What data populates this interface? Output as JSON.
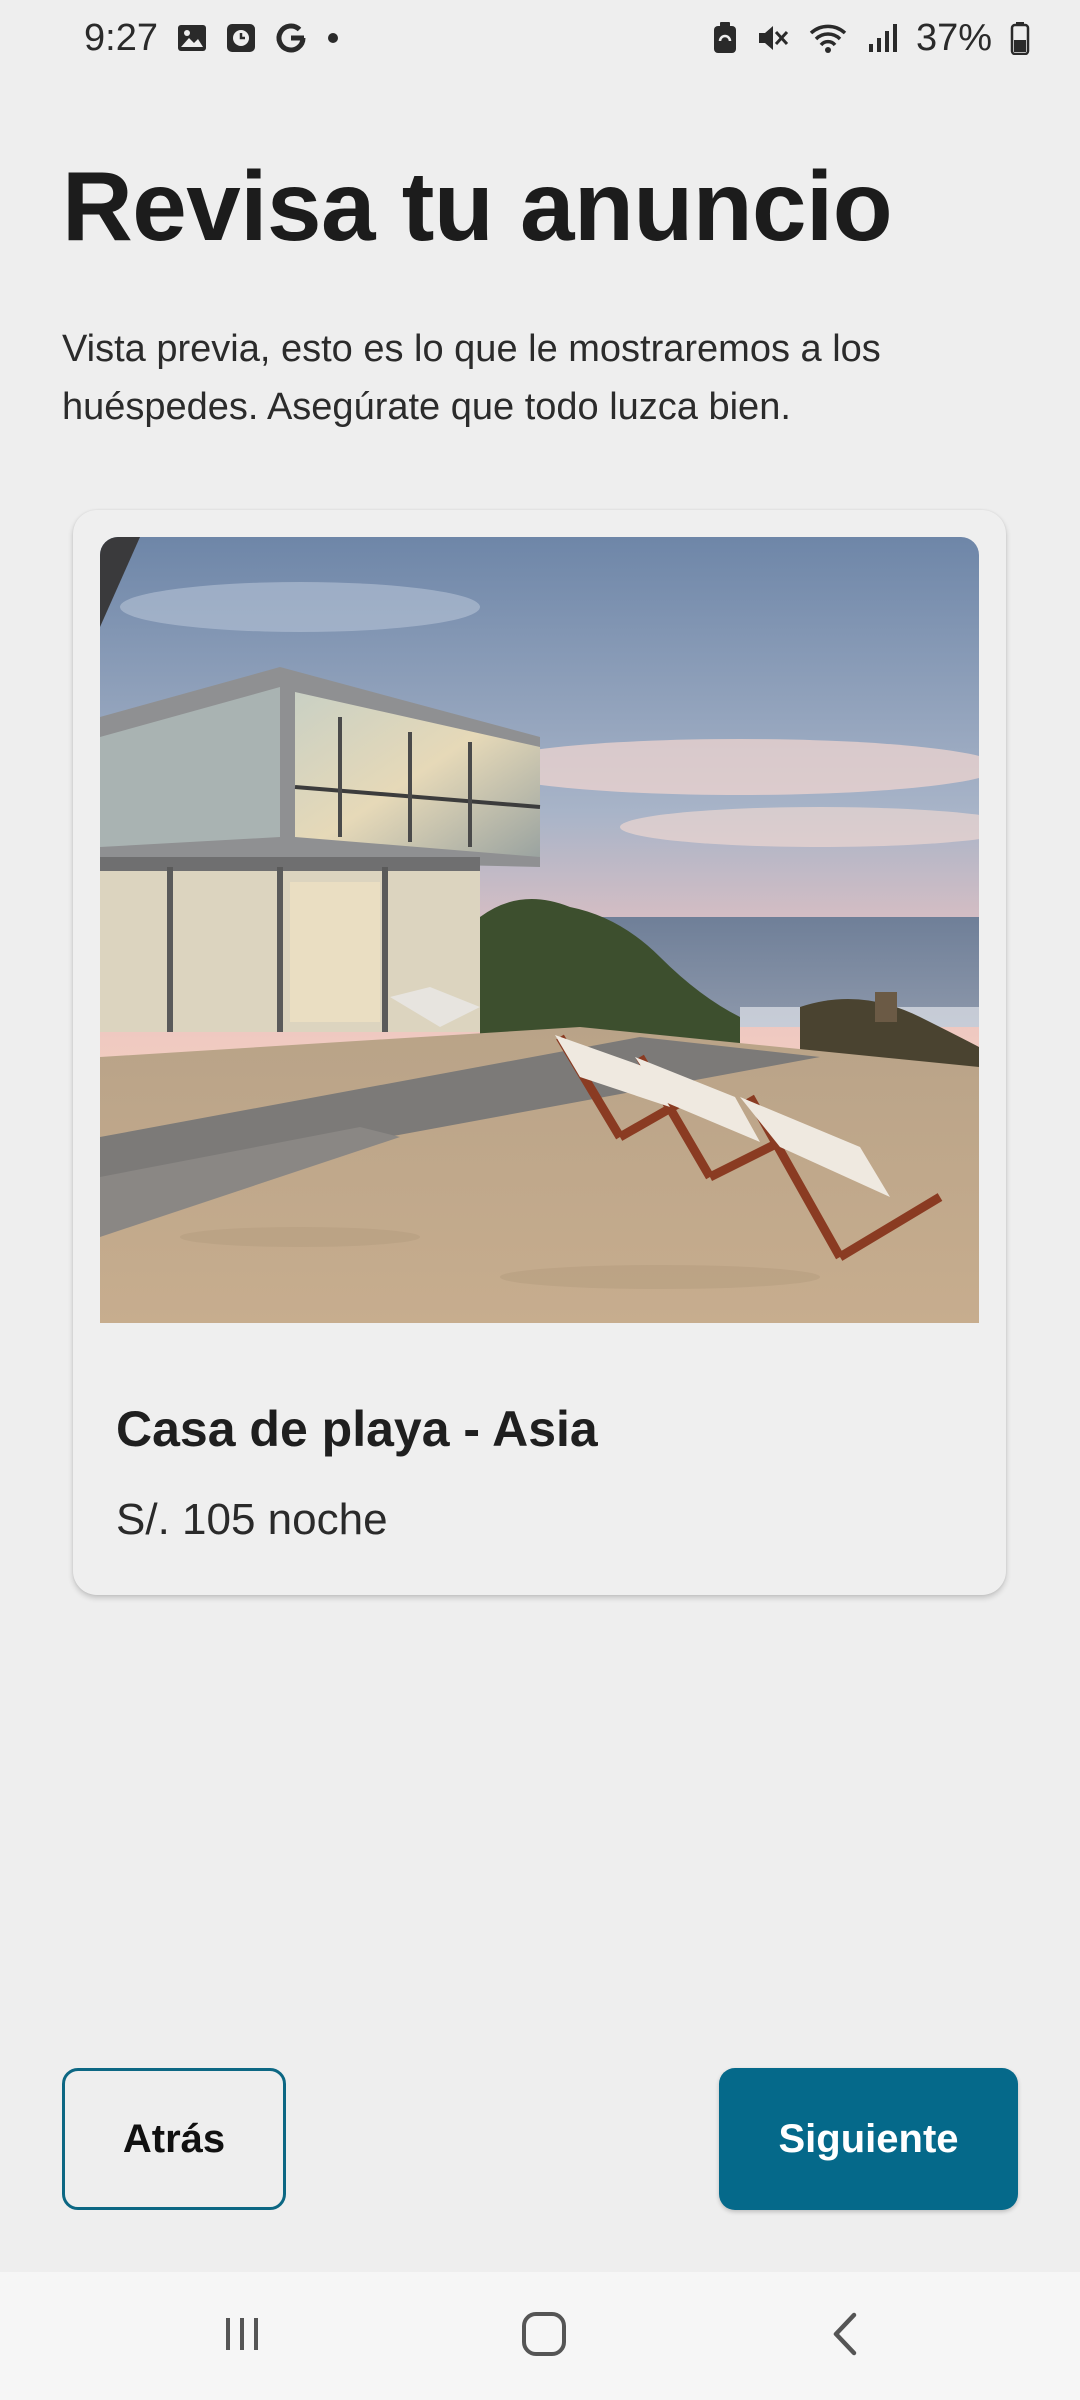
{
  "status_bar": {
    "time": "9:27",
    "battery": "37%",
    "left_icons": [
      "image-icon",
      "clock-app-icon",
      "google-icon",
      "dot-icon"
    ],
    "right_icons": [
      "battery-saver-icon",
      "mute-icon",
      "wifi-icon",
      "signal-icon",
      "battery-icon"
    ]
  },
  "page": {
    "title": "Revisa tu anuncio",
    "subtitle": "Vista previa, esto es lo que le mostraremos a los huéspedes. Asegúrate que todo luzca bien."
  },
  "listing": {
    "title": "Casa de playa - Asia",
    "price": "S/. 105 noche",
    "photo": "beach-house-photo"
  },
  "buttons": {
    "back_label": "Atrás",
    "next_label": "Siguiente"
  },
  "colors": {
    "primary": "#05698a",
    "background": "#eeeeee",
    "outline": "#0c6783"
  },
  "nav_bar": {
    "icons": [
      "recent-apps-icon",
      "home-icon",
      "back-icon"
    ]
  }
}
